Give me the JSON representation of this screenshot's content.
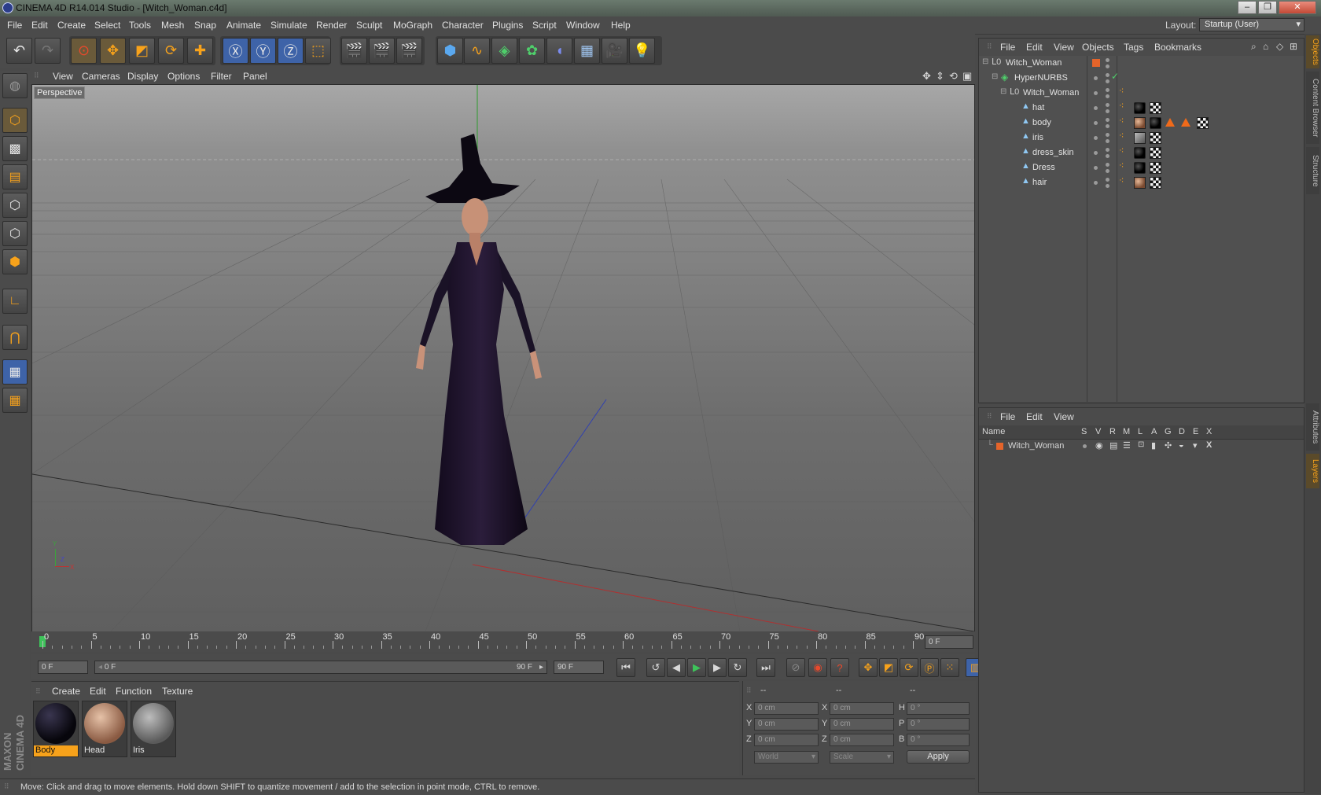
{
  "window": {
    "title": "CINEMA 4D R14.014 Studio - [Witch_Woman.c4d]",
    "controls": [
      "–",
      "❐",
      "✕"
    ]
  },
  "menubar": {
    "items": [
      "File",
      "Edit",
      "Create",
      "Select",
      "Tools",
      "Mesh",
      "Snap",
      "Animate",
      "Simulate",
      "Render",
      "Sculpt",
      "MoGraph",
      "Character",
      "Plugins",
      "Script",
      "Window",
      "Help"
    ],
    "layout_label": "Layout:",
    "layout_value": "Startup (User)"
  },
  "viewport": {
    "menu": [
      "View",
      "Cameras",
      "Display",
      "Options",
      "Filter",
      "Panel"
    ],
    "label": "Perspective",
    "axis_labels": {
      "x": "X",
      "y": "Y",
      "z": "Z"
    }
  },
  "timeline": {
    "ticks": [
      "0",
      "5",
      "10",
      "15",
      "20",
      "25",
      "30",
      "35",
      "40",
      "45",
      "50",
      "55",
      "60",
      "65",
      "70",
      "75",
      "80",
      "85",
      "90"
    ],
    "current_frame": "0 F"
  },
  "transport": {
    "start_field": "0 F",
    "range_start": "0 F",
    "range_end": "90 F",
    "end_field": "90 F"
  },
  "materials": {
    "menu": [
      "Create",
      "Edit",
      "Function",
      "Texture"
    ],
    "items": [
      {
        "name": "Body",
        "selected": true
      },
      {
        "name": "Head",
        "selected": false
      },
      {
        "name": "Iris",
        "selected": false
      }
    ]
  },
  "coordinates": {
    "headers": [
      "--",
      "--",
      "--"
    ],
    "rows": [
      {
        "pos_label": "X",
        "pos": "0 cm",
        "size_label": "X",
        "size": "0 cm",
        "rot_label": "H",
        "rot": "0 °"
      },
      {
        "pos_label": "Y",
        "pos": "0 cm",
        "size_label": "Y",
        "size": "0 cm",
        "rot_label": "P",
        "rot": "0 °"
      },
      {
        "pos_label": "Z",
        "pos": "0 cm",
        "size_label": "Z",
        "size": "0 cm",
        "rot_label": "B",
        "rot": "0 °"
      }
    ],
    "space_dropdown": "World",
    "mode_dropdown": "Scale",
    "apply_label": "Apply"
  },
  "status": {
    "text": "Move: Click and drag to move elements. Hold down SHIFT to quantize movement / add to the selection in point mode, CTRL to remove."
  },
  "objects_panel": {
    "menu": [
      "File",
      "Edit",
      "View",
      "Objects",
      "Tags",
      "Bookmarks"
    ],
    "rows": [
      {
        "name": "Witch_Woman",
        "type": "null"
      },
      {
        "name": "HyperNURBS",
        "type": "hypernurbs"
      },
      {
        "name": "Witch_Woman",
        "type": "null"
      },
      {
        "name": "hat",
        "type": "polygon"
      },
      {
        "name": "body",
        "type": "polygon"
      },
      {
        "name": "iris",
        "type": "polygon"
      },
      {
        "name": "dress_skin",
        "type": "polygon"
      },
      {
        "name": "Dress",
        "type": "polygon"
      },
      {
        "name": "hair",
        "type": "polygon"
      }
    ]
  },
  "layers_panel": {
    "menu": [
      "File",
      "Edit",
      "View"
    ],
    "columns": [
      "Name",
      "S",
      "V",
      "R",
      "M",
      "L",
      "A",
      "G",
      "D",
      "E",
      "X"
    ],
    "rows": [
      {
        "name": "Witch_Woman"
      }
    ]
  },
  "side_tabs": [
    "Objects",
    "Content Browser",
    "Structure",
    "Attributes",
    "Layers"
  ],
  "brand": "MAXON CINEMA 4D",
  "colors": {
    "accent": "#f7a21b",
    "selected": "#f7a21b",
    "layer": "#e5642a"
  }
}
